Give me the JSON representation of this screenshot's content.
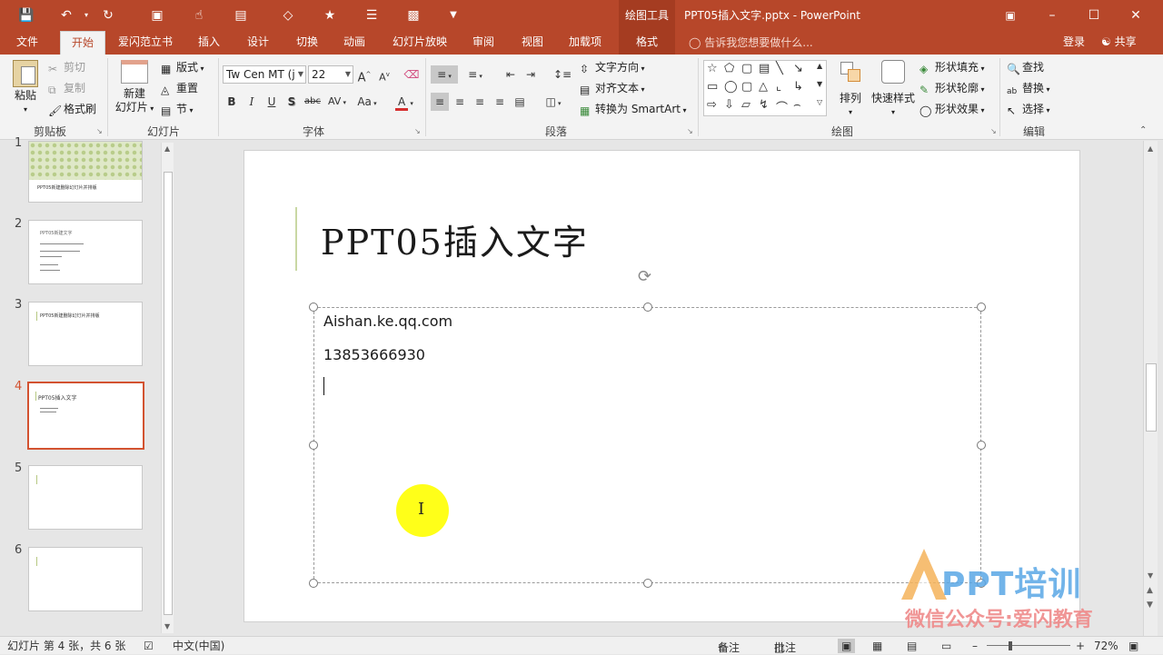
{
  "titlebar": {
    "context_tool": "绘图工具",
    "document_title": "PPT05插入文字.pptx - PowerPoint"
  },
  "tabs": {
    "file": "文件",
    "home": "开始",
    "aishan": "爱闪范立书",
    "insert": "插入",
    "design": "设计",
    "transitions": "切换",
    "animations": "动画",
    "slideshow": "幻灯片放映",
    "review": "审阅",
    "view": "视图",
    "addins": "加载项",
    "format": "格式",
    "tell_me": "告诉我您想要做什么...",
    "login": "登录",
    "share": "共享"
  },
  "ribbon": {
    "clipboard": {
      "paste": "粘贴",
      "cut": "剪切",
      "copy": "复制",
      "format_painter": "格式刷",
      "label": "剪贴板"
    },
    "slides": {
      "new_slide_line1": "新建",
      "new_slide_line2": "幻灯片",
      "layout": "版式",
      "reset": "重置",
      "section": "节",
      "label": "幻灯片"
    },
    "font": {
      "font_name": "Tw Cen MT (j",
      "font_size": "22",
      "label": "字体",
      "bold": "B",
      "italic": "I",
      "underline": "U",
      "shadow": "S",
      "strike": "abc",
      "spacing": "AV",
      "case": "Aa",
      "grow": "A",
      "shrink": "A"
    },
    "paragraph": {
      "text_direction": "文字方向",
      "align_text": "对齐文本",
      "smartart": "转换为 SmartArt",
      "label": "段落"
    },
    "drawing": {
      "arrange": "排列",
      "quick_styles": "快速样式",
      "shape_fill": "形状填充",
      "shape_outline": "形状轮廓",
      "shape_effects": "形状效果",
      "label": "绘图"
    },
    "editing": {
      "find": "查找",
      "replace": "替换",
      "select": "选择",
      "label": "编辑"
    }
  },
  "thumbnails": [
    {
      "num": "1",
      "text": "PPT05新建删除幻灯片并排版"
    },
    {
      "num": "2",
      "text": "PPT05新建文字"
    },
    {
      "num": "3",
      "text": "PPT05新建删除幻灯片并排版"
    },
    {
      "num": "4",
      "text": "PPT05插入文字"
    },
    {
      "num": "5",
      "text": ""
    },
    {
      "num": "6",
      "text": ""
    }
  ],
  "slide": {
    "title": "PPT05插入文字",
    "line1": "Aishan.ke.qq.com",
    "line2": "13853666930"
  },
  "watermark": {
    "brand": "PPT培训",
    "subtitle": "微信公众号:爱闪教育"
  },
  "status": {
    "slide_info": "幻灯片 第 4 张，共 6 张",
    "language": "中文(中国)",
    "notes": "备注",
    "comments": "批注",
    "zoom": "72%"
  },
  "colors": {
    "accent": "#b7472a",
    "selected_thumb": "#d35230",
    "cursor_highlight": "#ffff00"
  }
}
